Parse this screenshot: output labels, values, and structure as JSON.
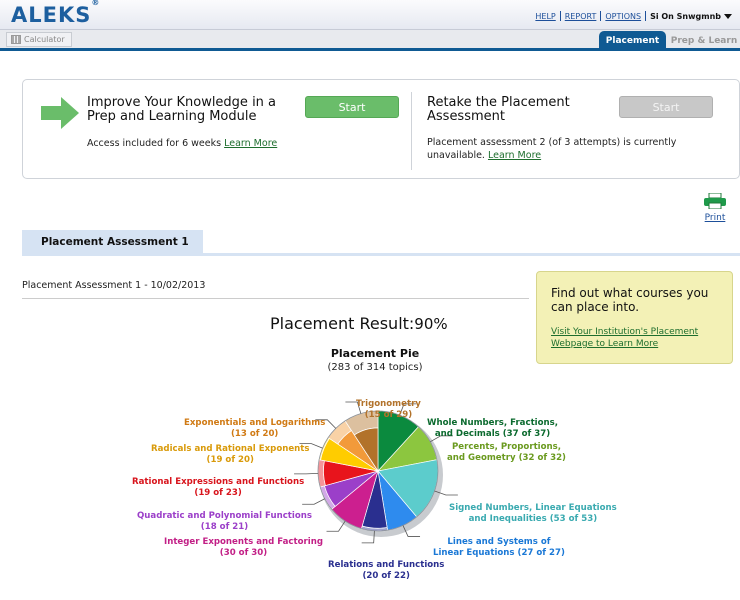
{
  "header": {
    "logo": "ALEKS",
    "logo_mark": "®",
    "links": [
      "HELP",
      "REPORT",
      "OPTIONS"
    ],
    "user": "Si On Snwgmnb"
  },
  "toolbar": {
    "calculator_label": "Calculator",
    "tabs": [
      "Placement",
      "Prep & Learn"
    ]
  },
  "action_box": {
    "left": {
      "title": "Improve Your Knowledge in a Prep and Learning Module",
      "text": "Access included for 6 weeks",
      "link": "Learn More",
      "button": "Start"
    },
    "right": {
      "title": "Retake the Placement Assessment",
      "text": "Placement assessment 2 (of 3 attempts) is currently unavailable.",
      "link": "Learn More",
      "button": "Start"
    }
  },
  "print_label": "Print",
  "assessment": {
    "tab": "Placement Assessment 1",
    "date_line": "Placement Assessment 1 - 10/02/2013",
    "result_label": "Placement Result:",
    "result_value": "90%",
    "pie_title": "Placement Pie",
    "pie_sub": "(283 of 314 topics)"
  },
  "find_box": {
    "title": "Find out what courses you can place into.",
    "link": "Visit Your Institution's Placement Webpage to Learn More"
  },
  "chart_data": {
    "type": "pie",
    "title": "Placement Pie",
    "subtitle": "(283 of 314 topics)",
    "series": [
      {
        "name": "Whole Numbers, Fractions, and Decimals",
        "mastered": 37,
        "total": 37,
        "color": "#0b8a3e",
        "label_color": "#0b6a2e"
      },
      {
        "name": "Percents, Proportions, and Geometry",
        "mastered": 32,
        "total": 32,
        "color": "#8cc63f",
        "label_color": "#6a9a1f"
      },
      {
        "name": "Signed Numbers, Linear Equations and Inequalities",
        "mastered": 53,
        "total": 53,
        "color": "#5ccccc",
        "label_color": "#3aaab0"
      },
      {
        "name": "Lines and Systems of Linear Equations",
        "mastered": 27,
        "total": 27,
        "color": "#2e8bee",
        "label_color": "#1a78d6"
      },
      {
        "name": "Relations and Functions",
        "mastered": 20,
        "total": 22,
        "color": "#2a2f8f",
        "label_color": "#2a2f8f"
      },
      {
        "name": "Integer Exponents and Factoring",
        "mastered": 30,
        "total": 30,
        "color": "#cc1f8f",
        "label_color": "#c21f86"
      },
      {
        "name": "Quadratic and Polynomial Functions",
        "mastered": 18,
        "total": 21,
        "color": "#9b3fc9",
        "label_color": "#9b3fc9"
      },
      {
        "name": "Rational Expressions and Functions",
        "mastered": 19,
        "total": 23,
        "color": "#e8141c",
        "label_color": "#d8141c"
      },
      {
        "name": "Radicals and Rational Exponents",
        "mastered": 19,
        "total": 20,
        "color": "#ffcc00",
        "label_color": "#d99a0a"
      },
      {
        "name": "Exponentials and Logarithms",
        "mastered": 13,
        "total": 20,
        "color": "#f29a3a",
        "label_color": "#d07a14"
      },
      {
        "name": "Trigonometry",
        "mastered": 15,
        "total": 29,
        "color": "#b2722a",
        "label_color": "#b2722a"
      }
    ]
  },
  "pie_labels": [
    [
      "Whole Numbers, Fractions,",
      "and Decimals (37 of 37)"
    ],
    [
      "Percents, Proportions,",
      "and Geometry (32 of 32)"
    ],
    [
      "Signed Numbers, Linear Equations",
      "and Inequalities (53 of 53)"
    ],
    [
      "Lines and Systems of",
      "Linear Equations (27 of 27)"
    ],
    [
      "Relations and Functions",
      "(20 of 22)"
    ],
    [
      "Integer Exponents and Factoring",
      "(30 of 30)"
    ],
    [
      "Quadratic and Polynomial Functions",
      "(18 of 21)"
    ],
    [
      "Rational Expressions and Functions",
      "(19 of 23)"
    ],
    [
      "Radicals and Rational Exponents",
      "(19 of 20)"
    ],
    [
      "Exponentials and Logarithms",
      "(13 of 20)"
    ],
    [
      "Trigonometry",
      "(15 of 29)"
    ]
  ]
}
